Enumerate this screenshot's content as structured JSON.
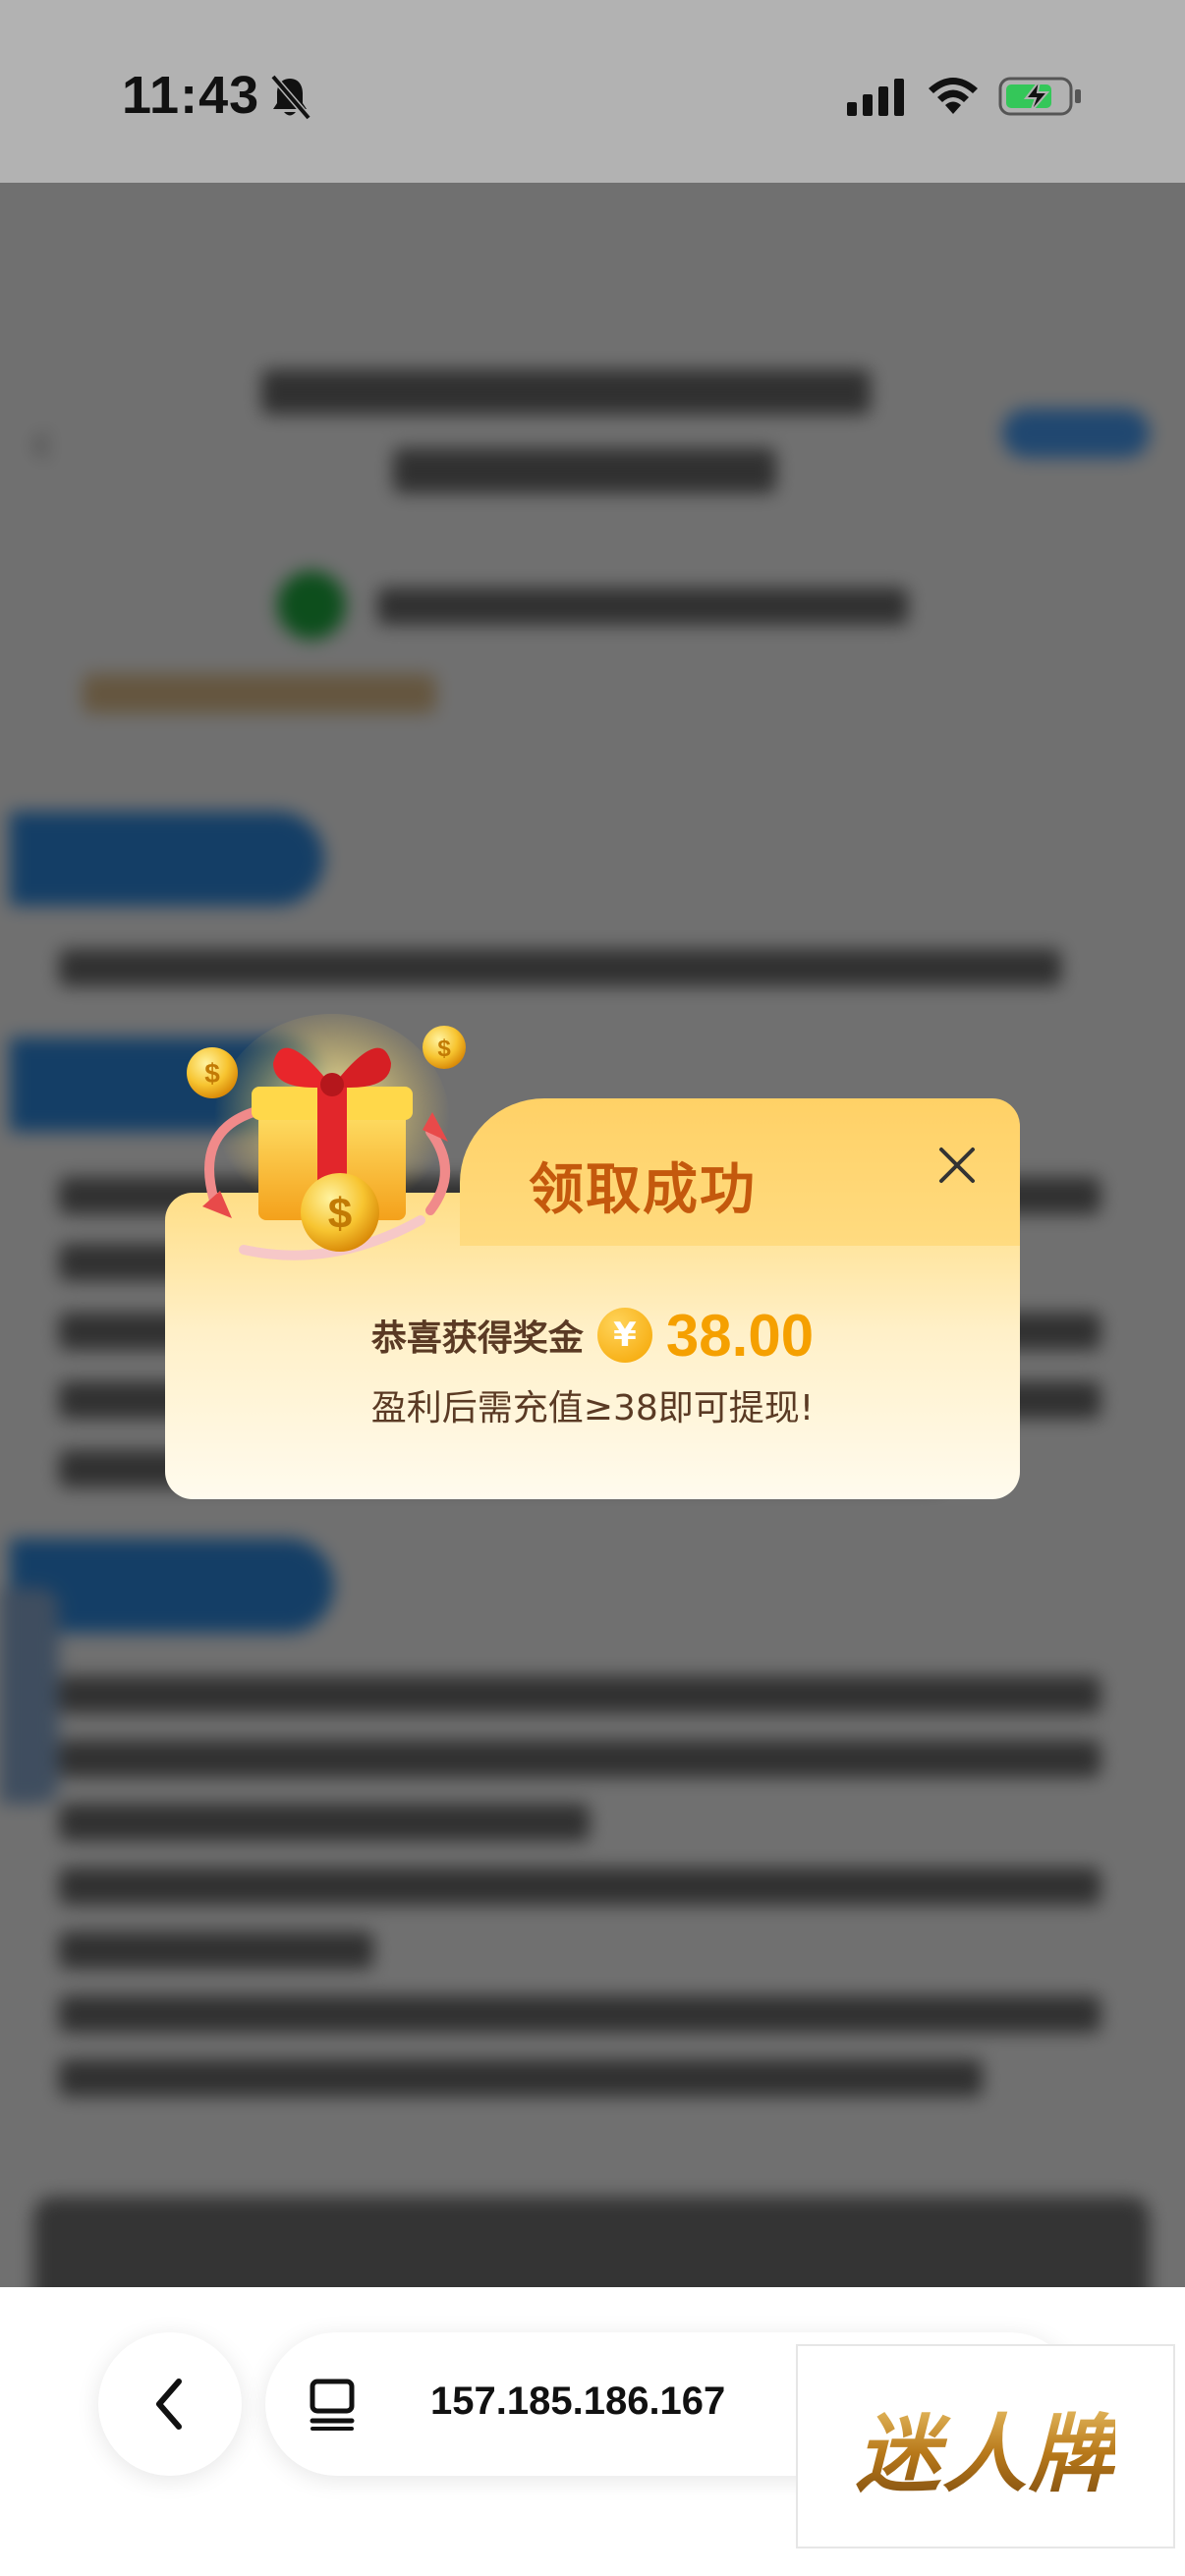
{
  "status_bar": {
    "time": "11:43",
    "icons": [
      "bell-slash-icon",
      "cellular-signal-icon",
      "wifi-icon",
      "battery-charging-icon"
    ]
  },
  "modal": {
    "title": "领取成功",
    "reward_label": "恭喜获得奖金",
    "currency_symbol": "¥",
    "amount": "38.00",
    "note": "盈利后需充值≥38即可提现!",
    "colors": {
      "title": "#c4590d",
      "amount": "#f5a000",
      "text": "#5a3a24",
      "panel": "#ffd166"
    }
  },
  "browser": {
    "address": "157.185.186.167",
    "icons": [
      "back-chevron-icon",
      "tabs-icon"
    ]
  },
  "brand": {
    "logo_text": "迷人牌"
  }
}
